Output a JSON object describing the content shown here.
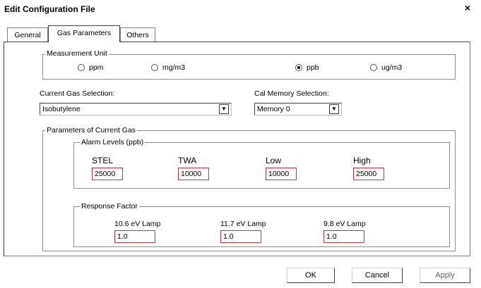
{
  "window": {
    "title": "Edit Configuration File",
    "close_glyph": "×"
  },
  "tabs": [
    {
      "label": "General",
      "active": false
    },
    {
      "label": "Gas Parameters",
      "active": true
    },
    {
      "label": "Others",
      "active": false
    }
  ],
  "measurement_unit": {
    "label": "Measurement Unit",
    "options": [
      {
        "label": "ppm",
        "selected": false
      },
      {
        "label": "mg/m3",
        "selected": false
      },
      {
        "label": "ppb",
        "selected": true
      },
      {
        "label": "ug/m3",
        "selected": false
      }
    ]
  },
  "current_gas": {
    "label": "Current Gas Selection:",
    "value": "Isobutylene",
    "dropdown_glyph": "▼"
  },
  "cal_memory": {
    "label": "Cal Memory Selection:",
    "value": "Memory 0",
    "dropdown_glyph": "▼"
  },
  "parameters": {
    "label": "Parameters of Current Gas",
    "alarm_levels": {
      "label": "Alarm Levels (ppb)",
      "fields": [
        {
          "label": "STEL",
          "value": "25000"
        },
        {
          "label": "TWA",
          "value": "10000"
        },
        {
          "label": "Low",
          "value": "10000"
        },
        {
          "label": "High",
          "value": "25000"
        }
      ]
    },
    "correction": {
      "label": "Response Factor",
      "lamps": [
        {
          "label": "10.6 eV Lamp",
          "value": "1.0"
        },
        {
          "label": "11.7 eV Lamp",
          "value": "1.0"
        },
        {
          "label": "9.8 eV Lamp",
          "value": "1.0"
        }
      ]
    }
  },
  "buttons": {
    "ok": "OK",
    "cancel": "Cancel",
    "apply": "Apply"
  }
}
